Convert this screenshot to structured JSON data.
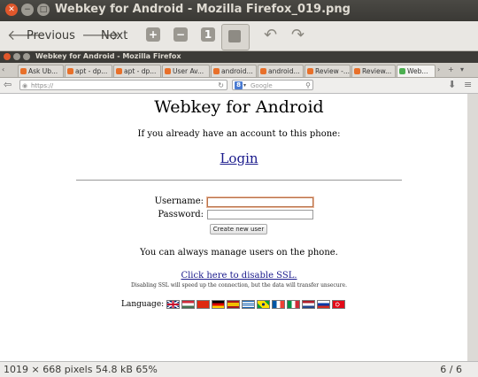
{
  "viewer": {
    "title": "Webkey for Android - Mozilla Firefox_019.png",
    "toolbar": {
      "previous": "Previous",
      "next": "Next",
      "fit_label": "1"
    },
    "status": {
      "info": "1019 × 668 pixels  54.8 kB   65%",
      "page": "6 / 6"
    }
  },
  "firefox": {
    "title": "Webkey for Android - Mozilla Firefox",
    "tabs": [
      "Ask Ub...",
      "apt - dp...",
      "apt - dp...",
      "User Av...",
      "android...",
      "android...",
      "Review -...",
      "Review...",
      "Web..."
    ],
    "url": "https://",
    "search_placeholder": "Google"
  },
  "page": {
    "heading": "Webkey for Android",
    "intro": "If you already have an account to this phone:",
    "login_link": "Login",
    "username_label": "Username:",
    "password_label": "Password:",
    "create_user_button": "Create new user",
    "manage_text": "You can always manage users on the phone.",
    "disable_ssl_link": "Click here to disable SSL.",
    "ssl_note": "Disabling SSL will speed up the connection, but the data will transfer unsecure.",
    "language_label": "Language:",
    "flags": [
      "uk",
      "hungary",
      "china",
      "germany",
      "spain",
      "greece",
      "brazil",
      "france",
      "italy",
      "netherlands",
      "russia",
      "turkey"
    ]
  }
}
